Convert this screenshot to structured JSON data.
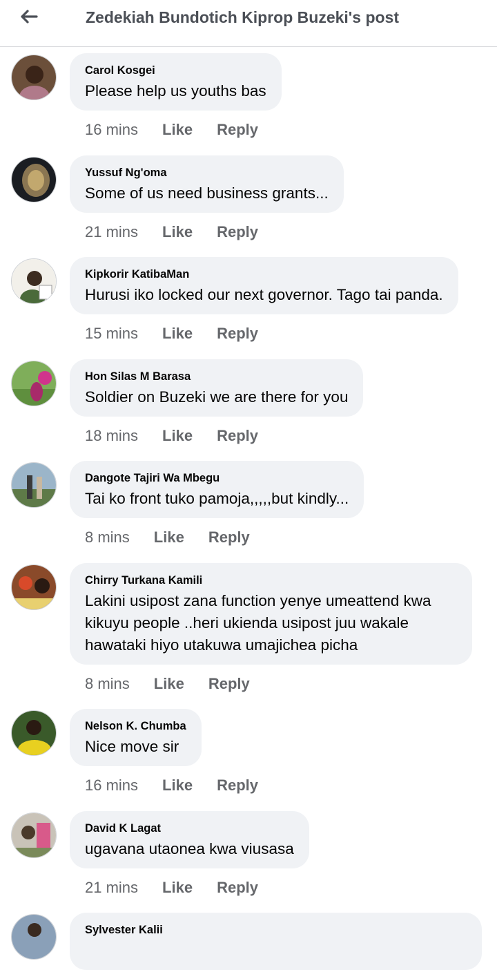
{
  "header": {
    "title": "Zedekiah Bundotich Kiprop Buzeki's post"
  },
  "actions": {
    "like": "Like",
    "reply": "Reply"
  },
  "comments": [
    {
      "author": "Carol Kosgei",
      "text": "Please help us youths bas",
      "time": "16 mins"
    },
    {
      "author": "Yussuf Ng'oma",
      "text": "Some of us need business grants...",
      "time": "21 mins"
    },
    {
      "author": "Kipkorir KatibaMan",
      "text": "Hurusi iko locked our next governor. Tago tai panda.",
      "time": "15 mins"
    },
    {
      "author": "Hon Silas M Barasa",
      "text": "Soldier on Buzeki we are there for you",
      "time": "18 mins"
    },
    {
      "author": "Dangote Tajiri Wa Mbegu",
      "text": "Tai ko front tuko pamoja,,,,,but kindly...",
      "time": "8 mins"
    },
    {
      "author": "Chirry Turkana Kamili",
      "text": "Lakini usipost zana function yenye umeattend kwa kikuyu people ..heri ukienda usipost juu wakale hawataki hiyo utakuwa umajichea picha",
      "time": "8 mins"
    },
    {
      "author": "Nelson K. Chumba",
      "text": "Nice move sir",
      "time": "16 mins"
    },
    {
      "author": "David K Lagat",
      "text": "ugavana utaonea kwa viusasa",
      "time": "21 mins"
    },
    {
      "author": "Sylvester Kalii",
      "text": "",
      "time": ""
    }
  ],
  "colors": {
    "bubble": "#f0f2f5",
    "meta": "#65676b",
    "title": "#4b4f56"
  },
  "icons": {
    "back": "arrow-left-icon"
  }
}
